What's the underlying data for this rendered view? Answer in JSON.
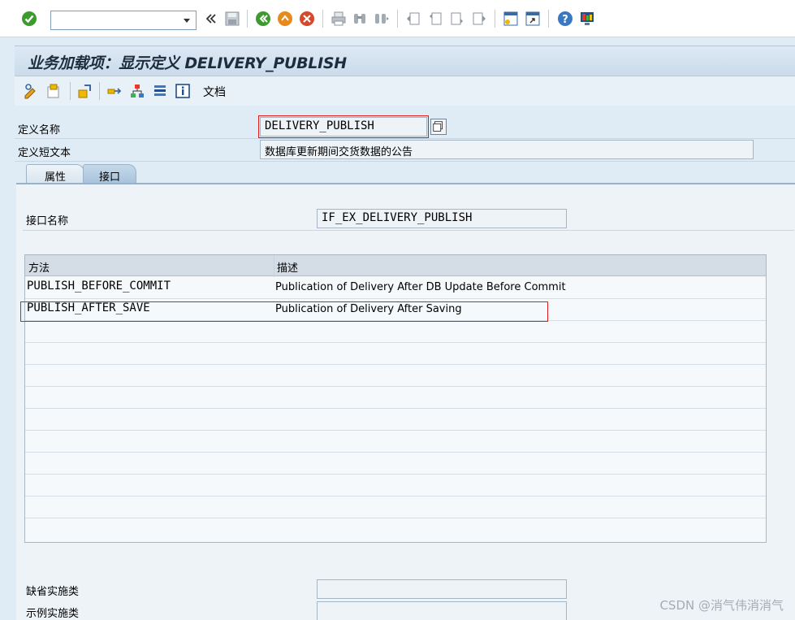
{
  "command_field": {
    "value": "",
    "placeholder": ""
  },
  "title": "业务加载项：显示定义 DELIVERY_PUBLISH",
  "toolbar": {
    "doc_label": "文档"
  },
  "fields": {
    "def_name_label": "定义名称",
    "def_name_value": "DELIVERY_PUBLISH",
    "def_short_label": "定义短文本",
    "def_short_value": "数据库更新期间交货数据的公告"
  },
  "tabs": [
    {
      "label": "属性"
    },
    {
      "label": "接口"
    }
  ],
  "interface": {
    "label": "接口名称",
    "value": "IF_EX_DELIVERY_PUBLISH"
  },
  "grid": {
    "columns": [
      "方法",
      "描述"
    ],
    "rows": [
      {
        "method": "PUBLISH_BEFORE_COMMIT",
        "desc": "Publication of Delivery After DB Update Before Commit"
      },
      {
        "method": "PUBLISH_AFTER_SAVE",
        "desc": "Publication of Delivery After Saving"
      }
    ]
  },
  "impl": {
    "default_label": "缺省实施类",
    "default_value": "",
    "example_label": "示例实施类",
    "example_value": ""
  },
  "watermark": "CSDN @消气伟消消气",
  "icons": [
    "check-icon",
    "chevron-down-icon",
    "back-double-icon",
    "save-icon",
    "back-icon",
    "exit-icon",
    "cancel-icon",
    "print-icon",
    "find-icon",
    "find-next-icon",
    "first-page-icon",
    "prev-page-icon",
    "next-page-icon",
    "last-page-icon",
    "new-session-icon",
    "shortcut-icon",
    "help-icon",
    "layout-icon"
  ],
  "colors": {
    "accent_green": "#3d9a2e",
    "accent_orange": "#e8891c",
    "accent_red": "#d6482a",
    "highlight_red": "#e01b1b"
  }
}
